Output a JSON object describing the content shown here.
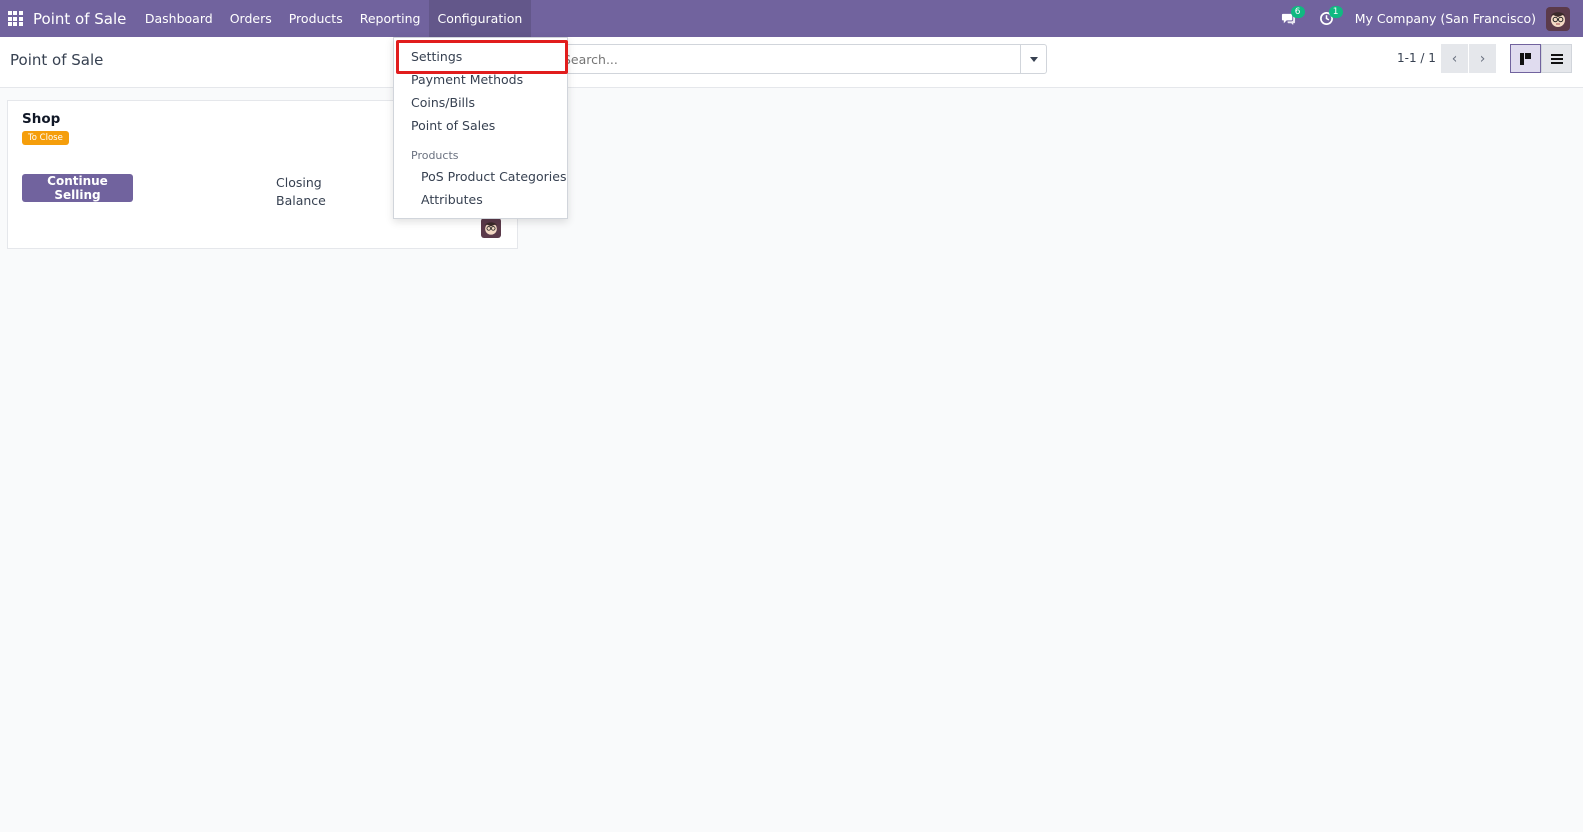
{
  "navbar": {
    "brand": "Point of Sale",
    "menu": [
      "Dashboard",
      "Orders",
      "Products",
      "Reporting",
      "Configuration"
    ],
    "messages_count": "6",
    "activities_count": "1",
    "company": "My Company (San Francisco)"
  },
  "control_panel": {
    "title": "Point of Sale",
    "search_placeholder": "Search...",
    "pager": "1-1 / 1"
  },
  "card": {
    "title": "Shop",
    "badge": "To Close",
    "button": "Continue Selling",
    "closing_label": "Closing Balance"
  },
  "dropdown": {
    "items": [
      "Settings",
      "Payment Methods",
      "Coins/Bills",
      "Point of Sales"
    ],
    "section_header": "Products",
    "sub_items": [
      "PoS Product Categories",
      "Attributes"
    ]
  },
  "colors": {
    "primary": "#71639e",
    "badge": "#f59e0b",
    "counter": "#10b981",
    "highlight": "#e11d1d"
  }
}
